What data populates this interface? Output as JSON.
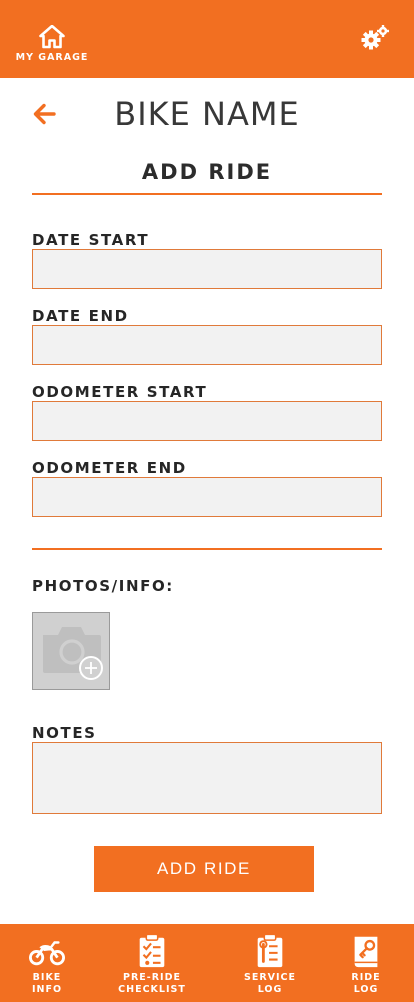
{
  "header": {
    "home_label": "MY GARAGE",
    "home_icon": "home-icon",
    "settings_icon": "gears-icon"
  },
  "page": {
    "title": "BIKE NAME",
    "back_icon": "arrow-left-icon",
    "section_title": "ADD RIDE"
  },
  "form": {
    "date_start_label": "DATE START",
    "date_start_value": "",
    "date_end_label": "DATE END",
    "date_end_value": "",
    "odometer_start_label": "ODOMETER START",
    "odometer_start_value": "",
    "odometer_end_label": "ODOMETER END",
    "odometer_end_value": "",
    "photos_label": "PHOTOS/INFO:",
    "add_photo_icon": "camera-add-icon",
    "notes_label": "NOTES",
    "notes_value": "",
    "submit_label": "ADD RIDE"
  },
  "bottom_nav": {
    "items": [
      {
        "label": "BIKE\nINFO",
        "icon": "motorcycle-icon"
      },
      {
        "label": "PRE-RIDE\nCHECKLIST",
        "icon": "checklist-icon"
      },
      {
        "label": "SERVICE\nLOG",
        "icon": "service-log-icon"
      },
      {
        "label": "RIDE\nLOG",
        "icon": "ride-log-icon"
      }
    ]
  },
  "colors": {
    "accent": "#f26f21",
    "input_background": "#f2f2f2",
    "text": "#333333"
  }
}
